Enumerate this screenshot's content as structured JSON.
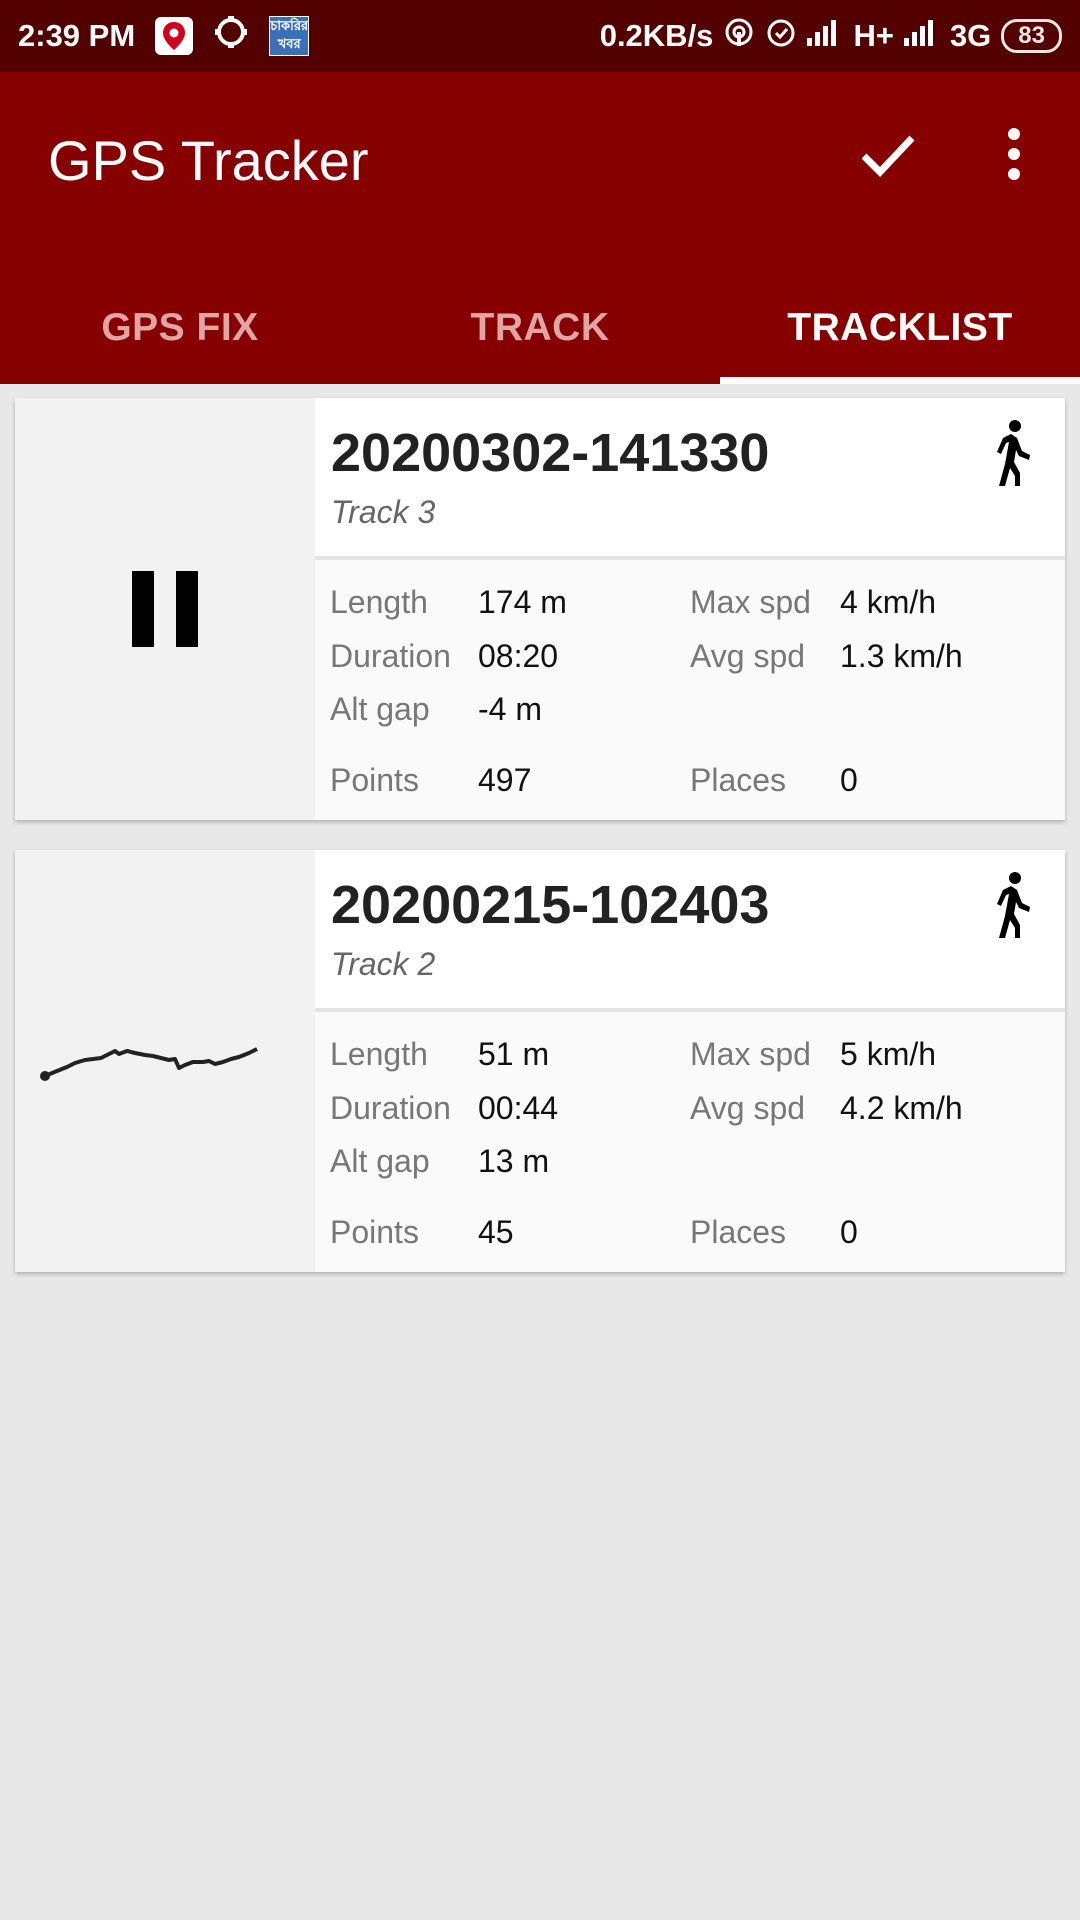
{
  "status_bar": {
    "time": "2:39 PM",
    "news_badge": "চাকরির খবর",
    "network_speed": "0.2KB/s",
    "signal1": "H+",
    "signal2": "3G",
    "battery": "83"
  },
  "app_bar": {
    "title": "GPS Tracker",
    "confirm_icon": "check-icon",
    "menu_icon": "more-vert-icon",
    "colors": {
      "primary": "#860000",
      "status": "#520000"
    }
  },
  "tabs": [
    {
      "label": "GPS FIX",
      "active": false
    },
    {
      "label": "TRACK",
      "active": false
    },
    {
      "label": "TRACKLIST",
      "active": true
    }
  ],
  "tracks": [
    {
      "name": "20200302-141330",
      "description": "Track 3",
      "thumbnail": "pause-icon",
      "activity_icon": "walk-icon",
      "labels": {
        "length": "Length",
        "duration": "Duration",
        "alt_gap": "Alt gap",
        "points": "Points",
        "max_spd": "Max spd",
        "avg_spd": "Avg spd",
        "places": "Places"
      },
      "length": "174 m",
      "duration": "08:20",
      "alt_gap": "-4 m",
      "points": "497",
      "max_spd": "4 km/h",
      "avg_spd": "1.3 km/h",
      "places": "0"
    },
    {
      "name": "20200215-102403",
      "description": "Track 2",
      "thumbnail": "track-path-preview",
      "activity_icon": "walk-icon",
      "labels": {
        "length": "Length",
        "duration": "Duration",
        "alt_gap": "Alt gap",
        "points": "Points",
        "max_spd": "Max spd",
        "avg_spd": "Avg spd",
        "places": "Places"
      },
      "length": "51 m",
      "duration": "00:44",
      "alt_gap": "13 m",
      "points": "45",
      "max_spd": "5 km/h",
      "avg_spd": "4.2 km/h",
      "places": "0"
    }
  ]
}
